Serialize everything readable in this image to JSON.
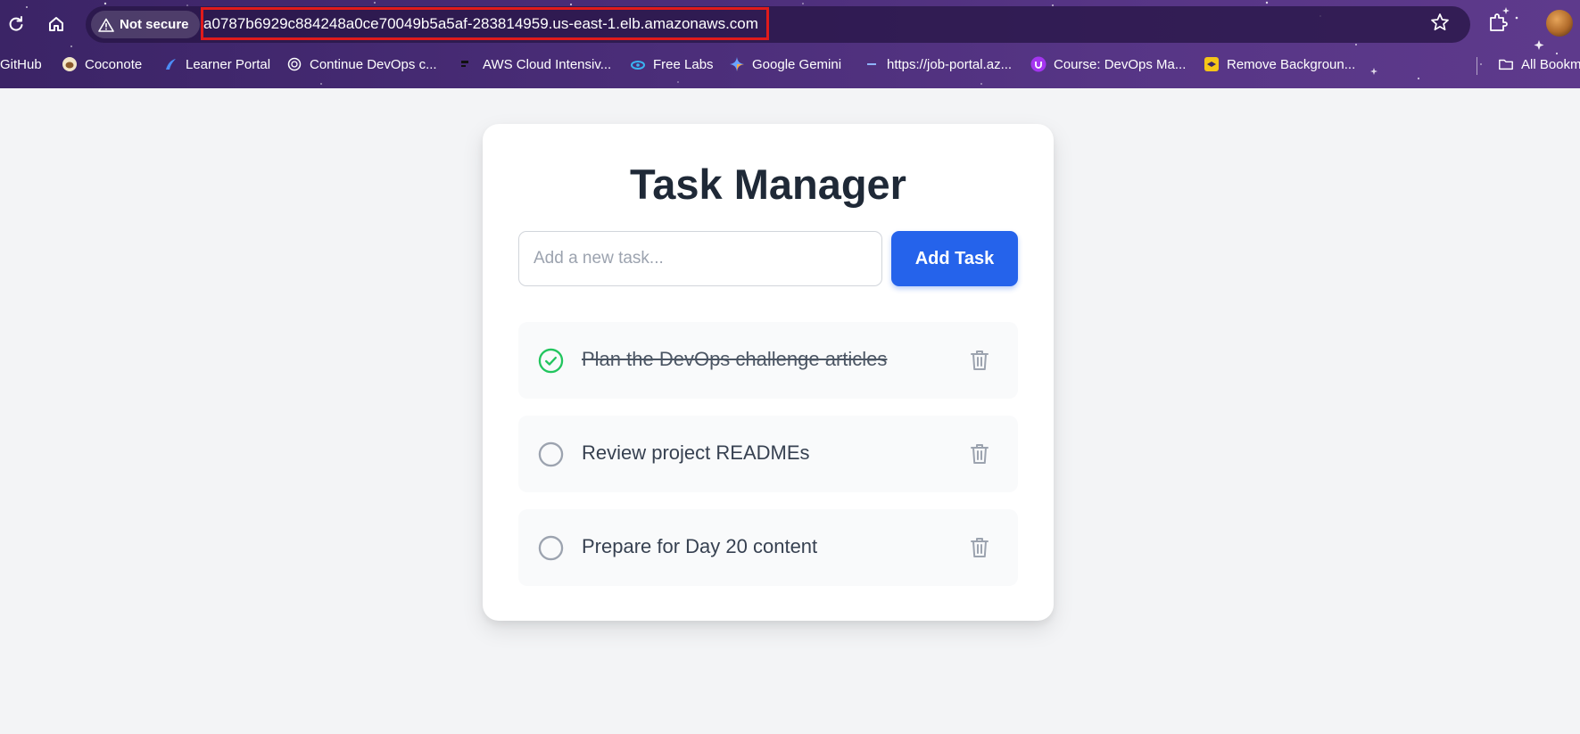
{
  "browser": {
    "security_label": "Not secure",
    "url": "a0787b6929c884248a0ce70049b5a5af-283814959.us-east-1.elb.amazonaws.com",
    "icons": [
      "reload-icon",
      "home-icon",
      "warning-icon",
      "star-icon",
      "extensions-icon",
      "avatar"
    ],
    "bookmarks": [
      {
        "label": "GitHub",
        "icon": "github-icon"
      },
      {
        "label": "Coconote",
        "icon": "coconote-icon"
      },
      {
        "label": "Learner Portal",
        "icon": "learner-portal-icon"
      },
      {
        "label": "Continue DevOps c...",
        "icon": "openai-icon"
      },
      {
        "label": "AWS Cloud Intensiv...",
        "icon": "aws-icon"
      },
      {
        "label": "Free Labs",
        "icon": "free-labs-icon"
      },
      {
        "label": "Google Gemini",
        "icon": "gemini-icon"
      },
      {
        "label": "https://job-portal.az...",
        "icon": "azure-icon"
      },
      {
        "label": "Course: DevOps Ma...",
        "icon": "udemy-icon"
      },
      {
        "label": "Remove Backgroun...",
        "icon": "remove-bg-icon"
      },
      {
        "label": "All Bookm",
        "icon": "folder-icon"
      }
    ]
  },
  "app": {
    "title": "Task Manager",
    "input_placeholder": "Add a new task...",
    "add_button_label": "Add Task",
    "tasks": [
      {
        "label": "Plan the DevOps challenge articles",
        "completed": true
      },
      {
        "label": "Review project READMEs",
        "completed": false
      },
      {
        "label": "Prepare for Day 20 content",
        "completed": false
      }
    ],
    "colors": {
      "accent": "#2563eb",
      "complete": "#22c55e",
      "pending": "#9ca3af",
      "chrome": "#4a2d78",
      "url_highlight": "#e01b1b"
    }
  }
}
